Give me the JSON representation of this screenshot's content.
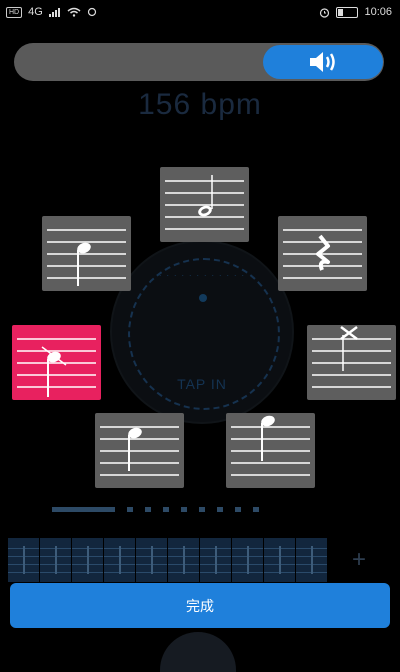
{
  "status_bar": {
    "left_badge": "HD",
    "network": "4G",
    "time": "10:06"
  },
  "volume": {
    "icon": "speaker-icon",
    "level": 0.7
  },
  "bpm": "156 bpm",
  "dial": {
    "label": "TAP IN"
  },
  "notes": [
    {
      "name": "half-note",
      "selected": false
    },
    {
      "name": "quarter-rest",
      "selected": false
    },
    {
      "name": "ghost-note",
      "selected": false
    },
    {
      "name": "eighth-note",
      "selected": false
    },
    {
      "name": "quarter-note",
      "selected": false
    },
    {
      "name": "accent-quarter-note",
      "selected": true
    },
    {
      "name": "eighth-note-up",
      "selected": false
    }
  ],
  "sequence": {
    "count": 10,
    "add_label": "+"
  },
  "done_button": "完成",
  "colors": {
    "accent": "#1f80db",
    "selected": "#e8215f",
    "card": "#5e5e5e"
  }
}
